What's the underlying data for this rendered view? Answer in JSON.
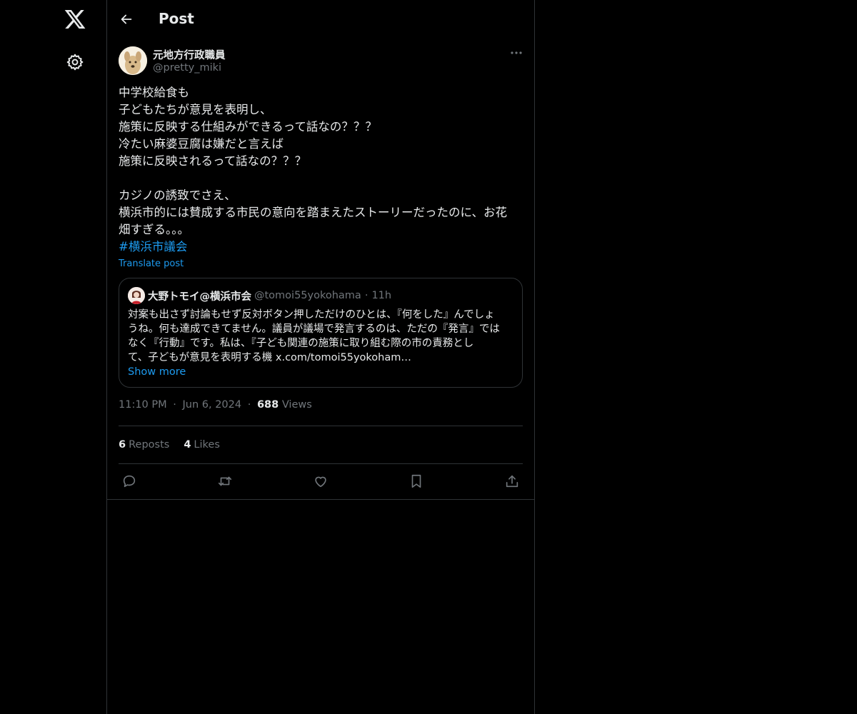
{
  "header": {
    "title": "Post"
  },
  "post": {
    "author_name": "元地方行政職員",
    "author_handle": "@pretty_miki",
    "text_lines": [
      "中学校給食も",
      "子どもたちが意見を表明し、",
      "施策に反映する仕組みができるって話なの？？？",
      "冷たい麻婆豆腐は嫌だと言えば",
      "施策に反映されるって話なの？？？",
      "",
      "カジノの誘致でさえ、",
      "横浜市的には賛成する市民の意向を踏まえたストーリーだったのに、お花",
      "畑すぎる。。。"
    ],
    "hashtag": "#横浜市議会",
    "translate_label": "Translate post",
    "quote": {
      "name": "大野トモイ@横浜市会",
      "handle": "@tomoi55yokohama",
      "dot": "·",
      "time": "11h",
      "text_lines": [
        "対案も出さず討論もせず反対ボタン押しただけのひとは、『何をした』んでしょ",
        "うね。何も達成できてません。議員が議場で発言するのは、ただの『発言』では",
        "なく『行動』です。私は、『子ども関連の施策に取り組む際の市の責務とし",
        "て、子どもが意見を表明する機 x.com/tomoi55yokoham…"
      ],
      "show_more": "Show more"
    },
    "meta": {
      "time": "11:10 PM",
      "dot1": "·",
      "date": "Jun 6, 2024",
      "dot2": "·",
      "views_count": "688",
      "views_label": "Views"
    },
    "stats": {
      "reposts_count": "6",
      "reposts_label": "Reposts",
      "likes_count": "4",
      "likes_label": "Likes"
    }
  },
  "icons": {
    "nav": [
      "x-logo-icon",
      "settings-gear-icon"
    ],
    "header": [
      "back-arrow-icon"
    ],
    "post": [
      "more-dots-icon"
    ],
    "actions": [
      "reply-icon",
      "repost-icon",
      "like-heart-icon",
      "bookmark-icon",
      "share-icon"
    ]
  },
  "colors": {
    "background": "#000000",
    "text": "#e7e9ea",
    "secondary": "#71767b",
    "accent": "#1d9bf0",
    "border": "#2f3336"
  }
}
